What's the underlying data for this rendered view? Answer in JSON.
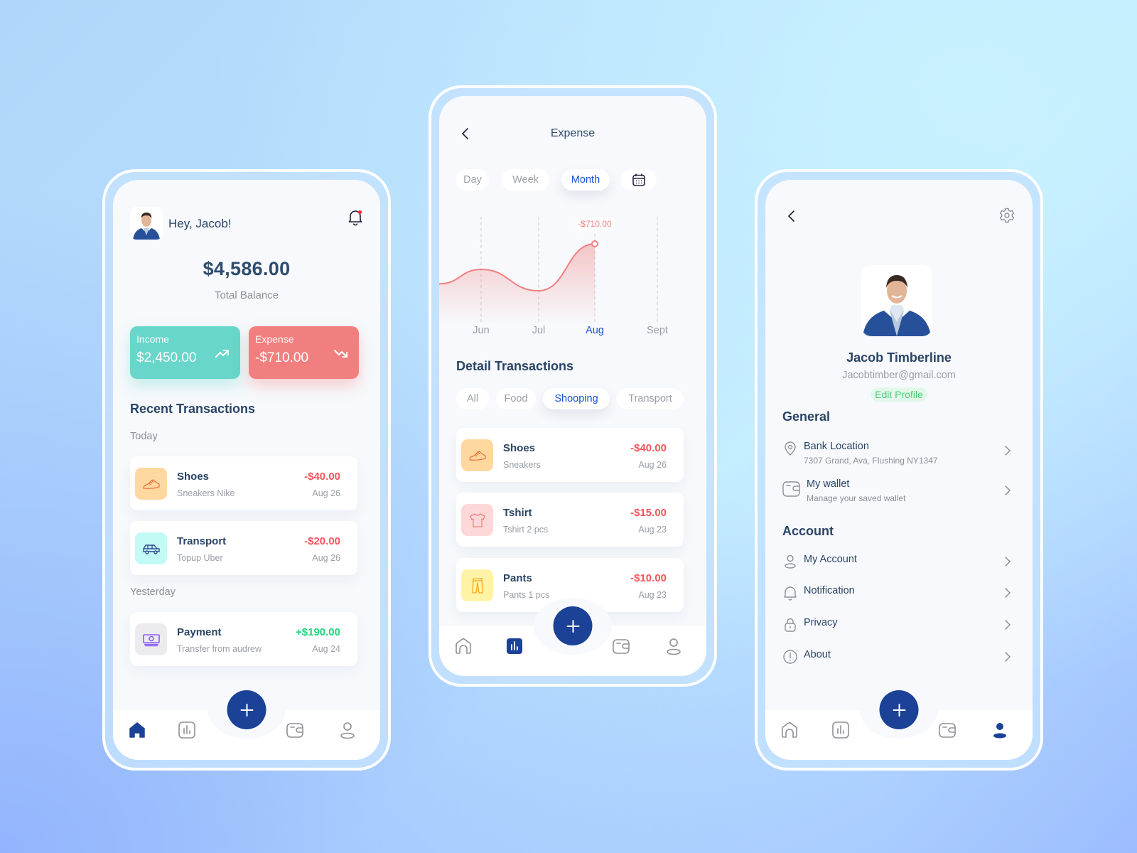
{
  "home": {
    "greeting": "Hey, Jacob!",
    "balance": "$4,586.00",
    "balance_label": "Total Balance",
    "income": {
      "label": "Income",
      "value": "$2,450.00",
      "color": "#68d6ca"
    },
    "expense": {
      "label": "Expense",
      "value": "-$710.00",
      "color": "#f27f7f"
    },
    "recent_title": "Recent Transactions",
    "groups": [
      {
        "label": "Today",
        "items": [
          {
            "name": "Shoes",
            "desc": "Sneakers Nike",
            "amount": "-$40.00",
            "date": "Aug 26",
            "icon": "shoe-icon"
          },
          {
            "name": "Transport",
            "desc": "Topup Uber",
            "amount": "-$20.00",
            "date": "Aug 26",
            "icon": "car-icon"
          }
        ]
      },
      {
        "label": "Yesterday",
        "items": [
          {
            "name": "Payment",
            "desc": "Transfer from audrew",
            "amount": "+$190.00",
            "date": "Aug 24",
            "icon": "money-icon"
          }
        ]
      }
    ],
    "nav_active": "home"
  },
  "expense": {
    "title": "Expense",
    "periods": [
      "Day",
      "Week",
      "Month"
    ],
    "period_active": "Month",
    "chart_data": {
      "type": "area",
      "categories": [
        "Jun",
        "Jul",
        "Aug",
        "Sept"
      ],
      "highlight": "Aug",
      "tooltip": "-$710.00",
      "relative_values": [
        0.55,
        0.3,
        0.85,
        null
      ],
      "color": "#f27f7f"
    },
    "detail_title": "Detail Transactions",
    "filters": [
      "All",
      "Food",
      "Shooping",
      "Transport"
    ],
    "filter_active": "Shooping",
    "items": [
      {
        "name": "Shoes",
        "desc": "Sneakers",
        "amount": "-$40.00",
        "date": "Aug 26",
        "icon": "shoe-icon"
      },
      {
        "name": "Tshirt",
        "desc": "Tshirt 2 pcs",
        "amount": "-$15.00",
        "date": "Aug 23",
        "icon": "tshirt-icon"
      },
      {
        "name": "Pants",
        "desc": "Pants 1 pcs",
        "amount": "-$10.00",
        "date": "Aug 23",
        "icon": "pants-icon"
      }
    ],
    "nav_active": "stats"
  },
  "profile": {
    "name": "Jacob Timberline",
    "email": "Jacobtimber@gmail.com",
    "edit_label": "Edit Profile",
    "general_title": "General",
    "general": [
      {
        "title": "Bank Location",
        "desc": "7307 Grand, Ava, Flushing NY1347",
        "icon": "location-pin-icon"
      },
      {
        "title": "My wallet",
        "desc": "Manage your saved wallet",
        "icon": "wallet-icon"
      }
    ],
    "account_title": "Account",
    "account": [
      {
        "title": "My Account",
        "icon": "user-icon"
      },
      {
        "title": "Notification",
        "icon": "bell-icon"
      },
      {
        "title": "Privacy",
        "icon": "lock-icon"
      },
      {
        "title": "About",
        "icon": "info-icon"
      }
    ],
    "nav_active": "profile"
  },
  "colors": {
    "primary": "#1b4296",
    "active_text": "#1a4fd6",
    "negative": "#f2545b",
    "positive": "#1ed47b",
    "heading": "#2a4466"
  }
}
